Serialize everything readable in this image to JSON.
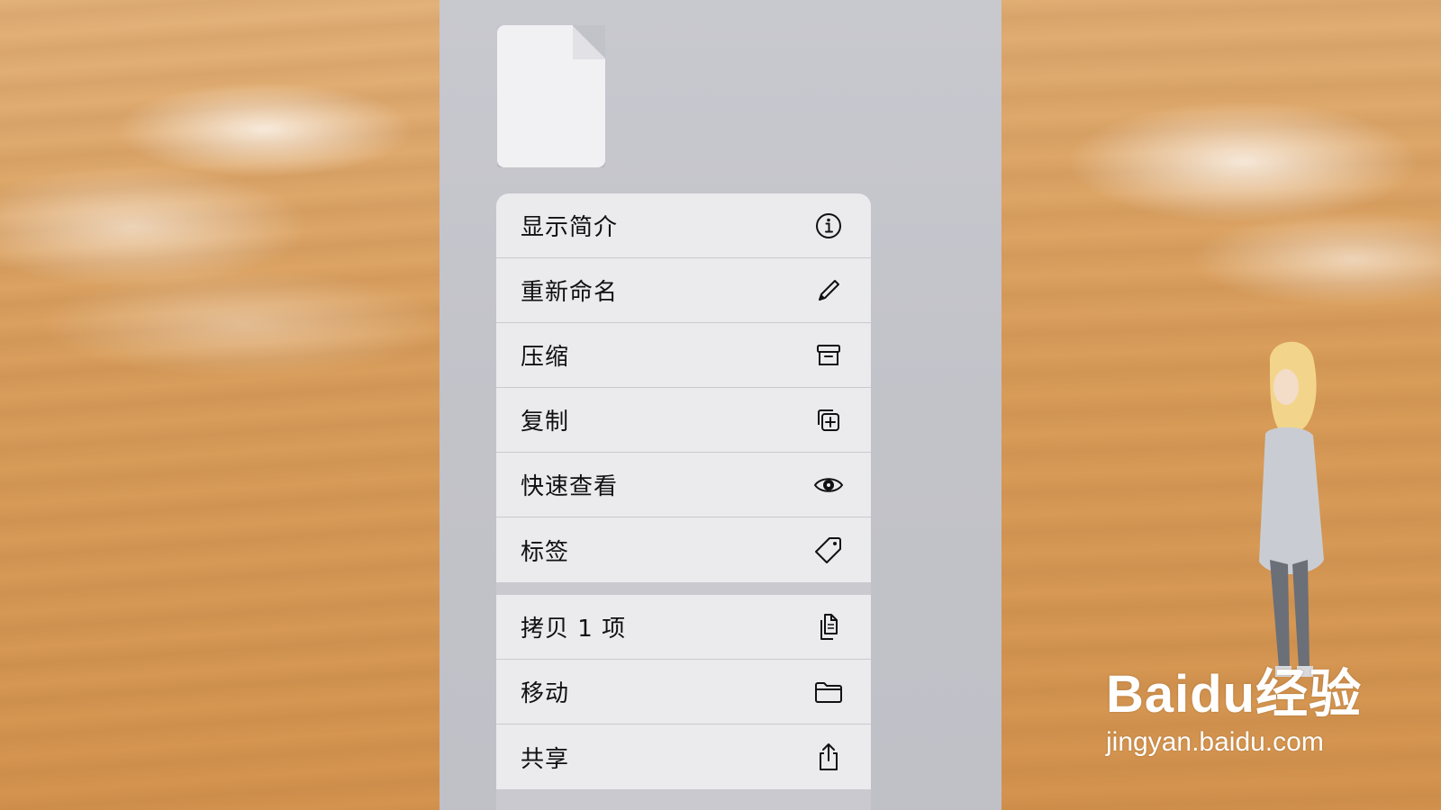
{
  "menu": {
    "items": [
      {
        "label": "显示简介",
        "icon": "info-icon"
      },
      {
        "label": "重新命名",
        "icon": "pencil-icon"
      },
      {
        "label": "压缩",
        "icon": "archive-box-icon"
      },
      {
        "label": "复制",
        "icon": "duplicate-icon"
      },
      {
        "label": "快速查看",
        "icon": "eye-icon"
      },
      {
        "label": "标签",
        "icon": "tag-icon"
      },
      {
        "label": "拷贝 1 项",
        "icon": "copy-documents-icon"
      },
      {
        "label": "移动",
        "icon": "folder-icon"
      },
      {
        "label": "共享",
        "icon": "share-icon"
      }
    ]
  },
  "watermark": {
    "logo": "Baidu经验",
    "url": "jingyan.baidu.com"
  },
  "colors": {
    "menu_item_bg": "#ebebee",
    "menu_separator": "#c9c9cf",
    "panel_bg": "#c4c4cb",
    "wood_bg": "#d59a55"
  }
}
